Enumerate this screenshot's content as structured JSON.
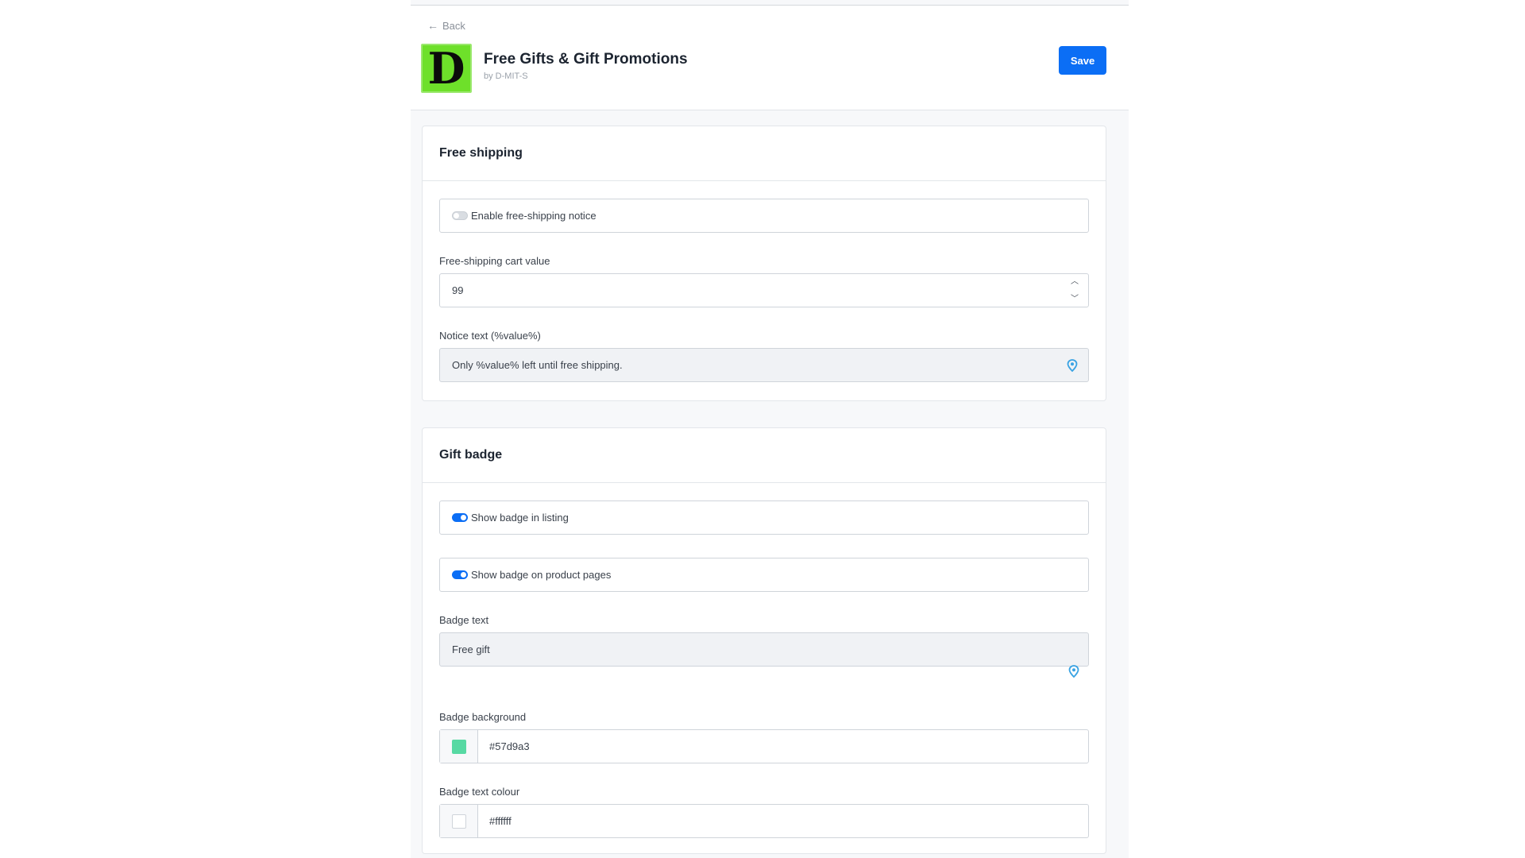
{
  "header": {
    "back_label": "Back",
    "app_logo_letter": "D",
    "app_title": "Free Gifts & Gift Promotions",
    "vendor": "by D-MIT-S",
    "save_label": "Save",
    "accent_color": "#0b6ef5"
  },
  "free_shipping": {
    "title": "Free shipping",
    "enable_toggle": {
      "label": "Enable free-shipping notice",
      "checked": false
    },
    "cart_value": {
      "label": "Free-shipping cart value",
      "value": "99"
    },
    "notice_text": {
      "label": "Notice text (%value%)",
      "value": "Only %value% left until free shipping."
    }
  },
  "gift_badge": {
    "title": "Gift badge",
    "show_in_listing": {
      "label": "Show badge in listing",
      "checked": true
    },
    "show_on_product": {
      "label": "Show badge on product pages",
      "checked": true
    },
    "badge_text": {
      "label": "Badge text",
      "value": "Free gift"
    },
    "badge_background": {
      "label": "Badge background",
      "value": "#57d9a3"
    },
    "badge_text_colour": {
      "label": "Badge text colour",
      "value": "#ffffff"
    }
  },
  "icons": {
    "back": "arrow-left-icon",
    "stepper_up": "chevron-up-icon",
    "stepper_down": "chevron-down-icon",
    "translate": "map-pin-icon"
  }
}
